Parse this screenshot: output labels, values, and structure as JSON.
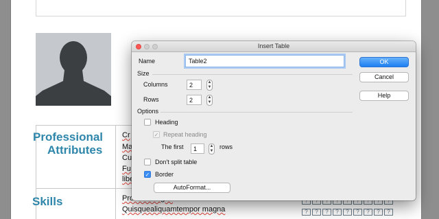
{
  "document": {
    "sections": {
      "professional_line1": "Professional",
      "professional_line2": "Attributes",
      "skills": "Skills"
    },
    "professional_lines": [
      "Cr",
      "Ma",
      "Cu",
      "Fu",
      "libe"
    ],
    "skills_lines": [
      "Proinnodaugus",
      "Quisquealiquamtempor magna"
    ],
    "unknown_glyph": "?"
  },
  "dialog": {
    "title": "Insert Table",
    "name_label": "Name",
    "name_value": "Table2",
    "size_label": "Size",
    "columns_label": "Columns",
    "columns_value": "2",
    "rows_label": "Rows",
    "rows_value": "2",
    "options_label": "Options",
    "heading_label": "Heading",
    "heading_checked": false,
    "repeat_heading_label": "Repeat heading",
    "repeat_heading_checked": true,
    "first_label": "The first",
    "first_value": "1",
    "rows_suffix": "rows",
    "dont_split_label": "Don't split table",
    "dont_split_checked": false,
    "border_label": "Border",
    "border_checked": true,
    "autoformat_label": "AutoFormat...",
    "buttons": {
      "ok": "OK",
      "cancel": "Cancel",
      "help": "Help"
    },
    "stepper_glyphs": {
      "up": "▲",
      "down": "▼"
    },
    "check_glyph": "✓",
    "colors": {
      "accent": "#1c7ff2",
      "close": "#fc5753",
      "heading_blue": "#2e86ab",
      "spell_error": "#e0443a"
    }
  }
}
